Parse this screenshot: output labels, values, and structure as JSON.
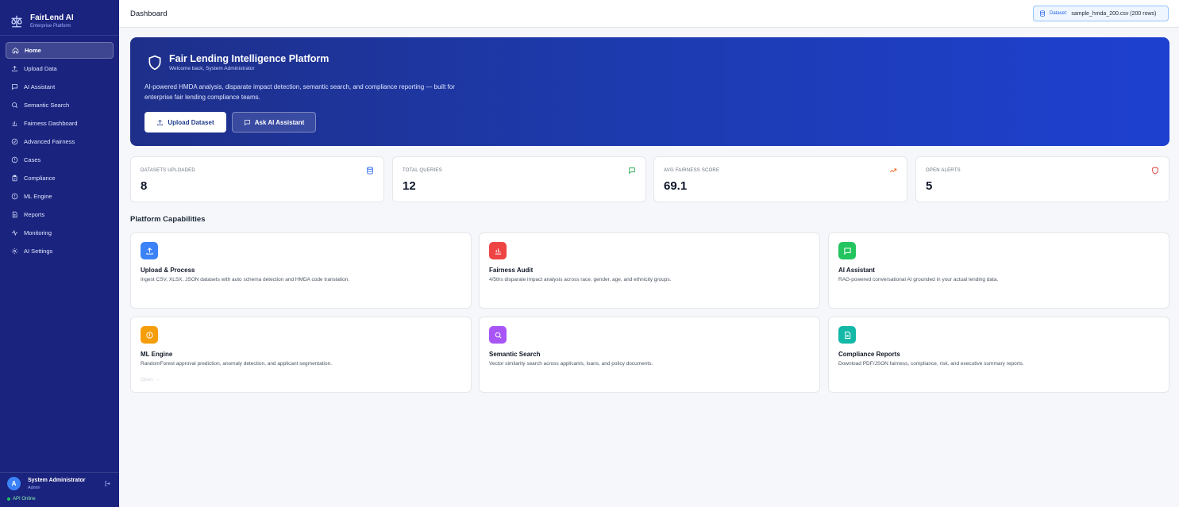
{
  "brand": {
    "title": "FairLend AI",
    "subtitle": "Enterprise Platform"
  },
  "sidebar": {
    "items": [
      {
        "label": "Home",
        "icon": "home-icon"
      },
      {
        "label": "Upload Data",
        "icon": "upload-icon"
      },
      {
        "label": "AI Assistant",
        "icon": "chat-icon"
      },
      {
        "label": "Semantic Search",
        "icon": "search-icon"
      },
      {
        "label": "Fairness Dashboard",
        "icon": "bar-chart-icon"
      },
      {
        "label": "Advanced Fairness",
        "icon": "check-circle-icon"
      },
      {
        "label": "Cases",
        "icon": "alert-circle-icon"
      },
      {
        "label": "Compliance",
        "icon": "clipboard-check-icon"
      },
      {
        "label": "ML Engine",
        "icon": "cpu-icon"
      },
      {
        "label": "Reports",
        "icon": "file-icon"
      },
      {
        "label": "Monitoring",
        "icon": "activity-icon"
      },
      {
        "label": "AI Settings",
        "icon": "settings-icon"
      }
    ],
    "active_index": 0
  },
  "user": {
    "initial": "A",
    "name": "System Administrator",
    "role": "Admin",
    "api_status": "API Online"
  },
  "header": {
    "title": "Dashboard",
    "dataset_label": "Dataset:",
    "dataset_value": "sample_hmda_200.csv (200 rows)"
  },
  "hero": {
    "title": "Fair Lending Intelligence Platform",
    "welcome": "Welcome back, System Administrator",
    "description": "AI-powered HMDA analysis, disparate impact detection, semantic search, and compliance reporting — built for enterprise fair lending compliance teams.",
    "upload_button": "Upload Dataset",
    "ask_button": "Ask AI Assistant"
  },
  "stats": [
    {
      "label": "Datasets Uploaded",
      "value": "8",
      "icon": "database-icon",
      "color": "#2563eb"
    },
    {
      "label": "Total Queries",
      "value": "12",
      "icon": "chat-icon",
      "color": "#16a34a"
    },
    {
      "label": "Avg Fairness Score",
      "value": "69.1",
      "icon": "trending-up-icon",
      "color": "#ea580c"
    },
    {
      "label": "Open Alerts",
      "value": "5",
      "icon": "shield-alert-icon",
      "color": "#dc2626"
    }
  ],
  "capabilities": {
    "title": "Platform Capabilities",
    "items": [
      {
        "title": "Upload & Process",
        "desc": "Ingest CSV, XLSX, JSON datasets with auto schema detection and HMDA code translation.",
        "icon": "upload-icon",
        "color": "#3b82f6"
      },
      {
        "title": "Fairness Audit",
        "desc": "4/5ths disparate impact analysis across race, gender, age, and ethnicity groups.",
        "icon": "bar-chart-icon",
        "color": "#ef4444"
      },
      {
        "title": "AI Assistant",
        "desc": "RAG-powered conversational AI grounded in your actual lending data.",
        "icon": "chat-icon",
        "color": "#22c55e"
      },
      {
        "title": "ML Engine",
        "desc": "RandomForest approval prediction, anomaly detection, and applicant segmentation.",
        "icon": "cpu-icon",
        "color": "#f59e0b",
        "open_label": "Open →"
      },
      {
        "title": "Semantic Search",
        "desc": "Vector similarity search across applicants, loans, and policy documents.",
        "icon": "search-icon",
        "color": "#a855f7"
      },
      {
        "title": "Compliance Reports",
        "desc": "Download PDF/JSON fairness, compliance, risk, and executive summary reports.",
        "icon": "file-icon",
        "color": "#14b8a6"
      }
    ]
  }
}
